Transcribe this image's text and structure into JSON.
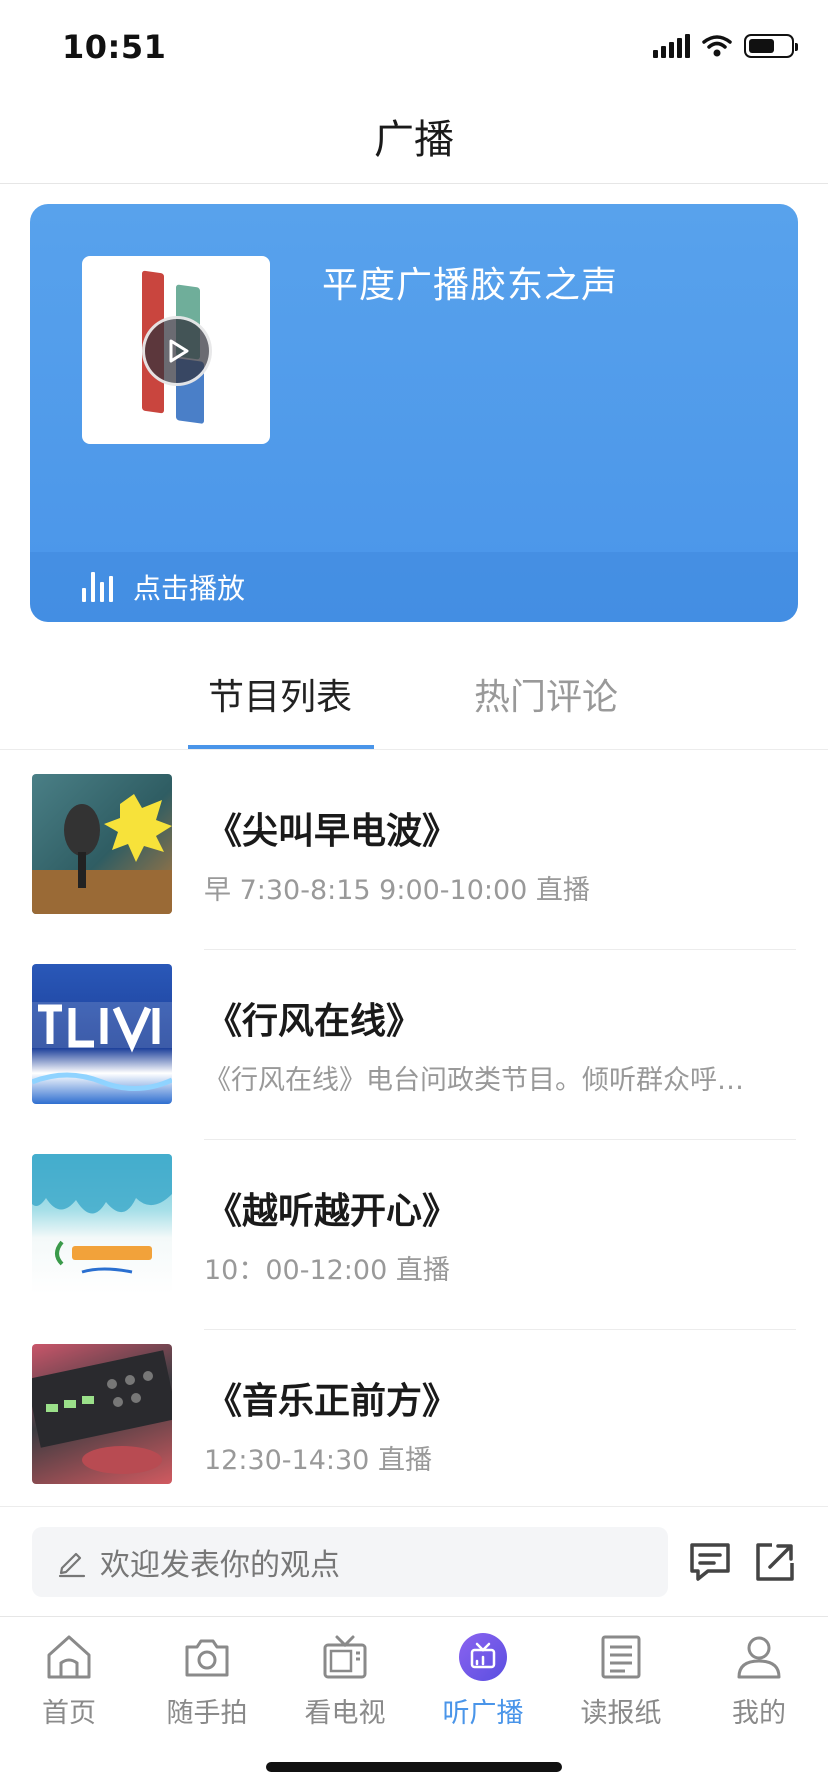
{
  "status_bar": {
    "time": "10:51",
    "battery_level": 0.62,
    "icons": [
      "signal-icon",
      "wifi-icon",
      "battery-icon"
    ]
  },
  "nav": {
    "title": "广播"
  },
  "hero": {
    "station_name": "平度广播胶东之声",
    "play_label": "点击播放",
    "colors": {
      "card": "#4a95e9",
      "logo_red": "#c9453e",
      "logo_green": "#6fae9a",
      "logo_blue": "#4a7fc8"
    }
  },
  "tabs": [
    {
      "label": "节目列表",
      "active": true
    },
    {
      "label": "热门评论",
      "active": false
    }
  ],
  "programs": [
    {
      "title": "《尖叫早电波》",
      "desc": "早 7:30-8:15 9:00-10:00 直播"
    },
    {
      "title": "《行风在线》",
      "desc": "《行风在线》电台问政类节目。倾听群众呼…"
    },
    {
      "title": "《越听越开心》",
      "desc": "10：00-12:00 直播"
    },
    {
      "title": "《音乐正前方》",
      "desc": "12:30-14:30 直播"
    }
  ],
  "comment_bar": {
    "placeholder": "欢迎发表你的观点",
    "icons": [
      "comment-icon",
      "share-icon"
    ]
  },
  "tabbar": {
    "active_index": 3,
    "accent_color": "#4a95e9",
    "items": [
      {
        "label": "首页",
        "icon": "home-icon"
      },
      {
        "label": "随手拍",
        "icon": "camera-icon"
      },
      {
        "label": "看电视",
        "icon": "tv-icon"
      },
      {
        "label": "听广播",
        "icon": "radio-icon"
      },
      {
        "label": "读报纸",
        "icon": "newspaper-icon"
      },
      {
        "label": "我的",
        "icon": "profile-icon"
      }
    ]
  }
}
